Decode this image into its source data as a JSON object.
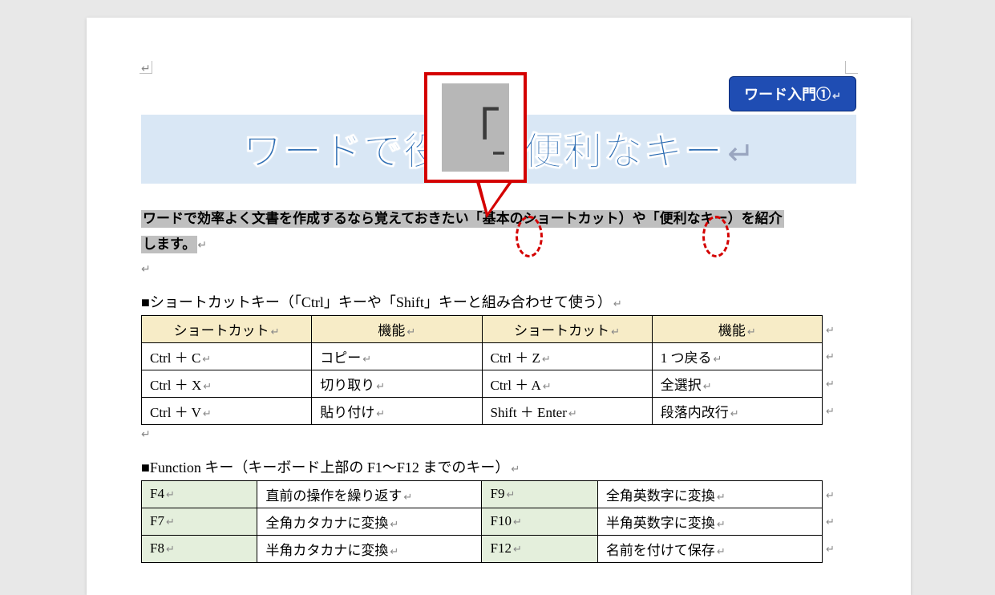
{
  "badge": {
    "label": "ワード入門①"
  },
  "title": "ワードで役立つ便利なキー",
  "intro_line1": "ワードで効率よく文書を作成するなら覚えておきたい「基本のショートカット）や「便利なキー）を紹介",
  "intro_line2": "します。",
  "callout_symbol": "「",
  "section1": {
    "heading": "■ショートカットキー（「Ctrl」キーや「Shift」キーと組み合わせて使う）",
    "headers": [
      "ショートカット",
      "機能",
      "ショートカット",
      "機能"
    ],
    "rows": [
      [
        "Ctrl ＋ C",
        "コピー",
        "Ctrl ＋ Z",
        "1 つ戻る"
      ],
      [
        "Ctrl ＋ X",
        "切り取り",
        "Ctrl ＋ A",
        "全選択"
      ],
      [
        "Ctrl ＋ V",
        "貼り付け",
        "Shift ＋ Enter",
        "段落内改行"
      ]
    ]
  },
  "section2": {
    "heading": "■Function キー（キーボード上部の F1～F12 までのキー）",
    "rows": [
      [
        "F4",
        "直前の操作を繰り返す",
        "F9",
        "全角英数字に変換"
      ],
      [
        "F7",
        "全角カタカナに変換",
        "F10",
        "半角英数字に変換"
      ],
      [
        "F8",
        "半角カタカナに変換",
        "F12",
        "名前を付けて保存"
      ]
    ]
  },
  "marks": {
    "return": "↵"
  }
}
